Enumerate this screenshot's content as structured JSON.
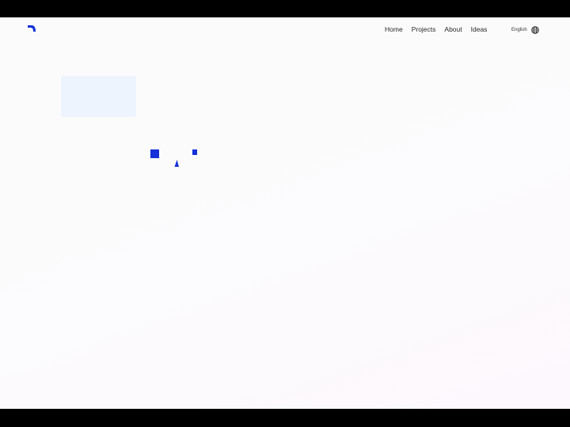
{
  "colors": {
    "accent": "#1531d8",
    "nav_text": "#2a2a2a",
    "placeholder": "#eef4fd",
    "letterbox": "#000000"
  },
  "header": {
    "logo_icon": "brand-arc-icon",
    "nav": {
      "home": "Home",
      "projects": "Projects",
      "about": "About",
      "ideas": "Ideas"
    },
    "language": {
      "label": "English",
      "icon": "globe-icon"
    }
  }
}
